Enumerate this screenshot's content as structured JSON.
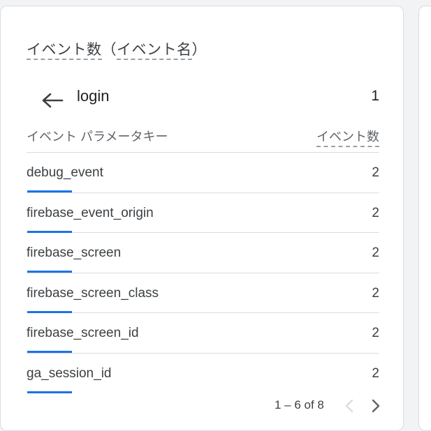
{
  "card": {
    "title_part1": "イベント数",
    "title_paren_open": "（",
    "title_part2": "イベント名",
    "title_paren_close": "）"
  },
  "header": {
    "event_name": "login",
    "event_count": "1"
  },
  "columns": {
    "key_label": "イベント パラメータキー",
    "count_label": "イベント数"
  },
  "rows": [
    {
      "label": "debug_event",
      "value": "2",
      "share": 0.25
    },
    {
      "label": "firebase_event_origin",
      "value": "2",
      "share": 0.25
    },
    {
      "label": "firebase_screen",
      "value": "2",
      "share": 0.25
    },
    {
      "label": "firebase_screen_class",
      "value": "2",
      "share": 0.25
    },
    {
      "label": "firebase_screen_id",
      "value": "2",
      "share": 0.25
    },
    {
      "label": "ga_session_id",
      "value": "2",
      "share": 0.25
    }
  ],
  "pagination": {
    "range_text": "1 – 6 of 8"
  },
  "icons": {
    "back": "arrow-back-icon",
    "prev": "chevron-left-icon",
    "next": "chevron-right-icon"
  },
  "colors": {
    "accent_bar": "#1a73e8",
    "disabled": "#dadce0",
    "enabled": "#5f6368"
  }
}
